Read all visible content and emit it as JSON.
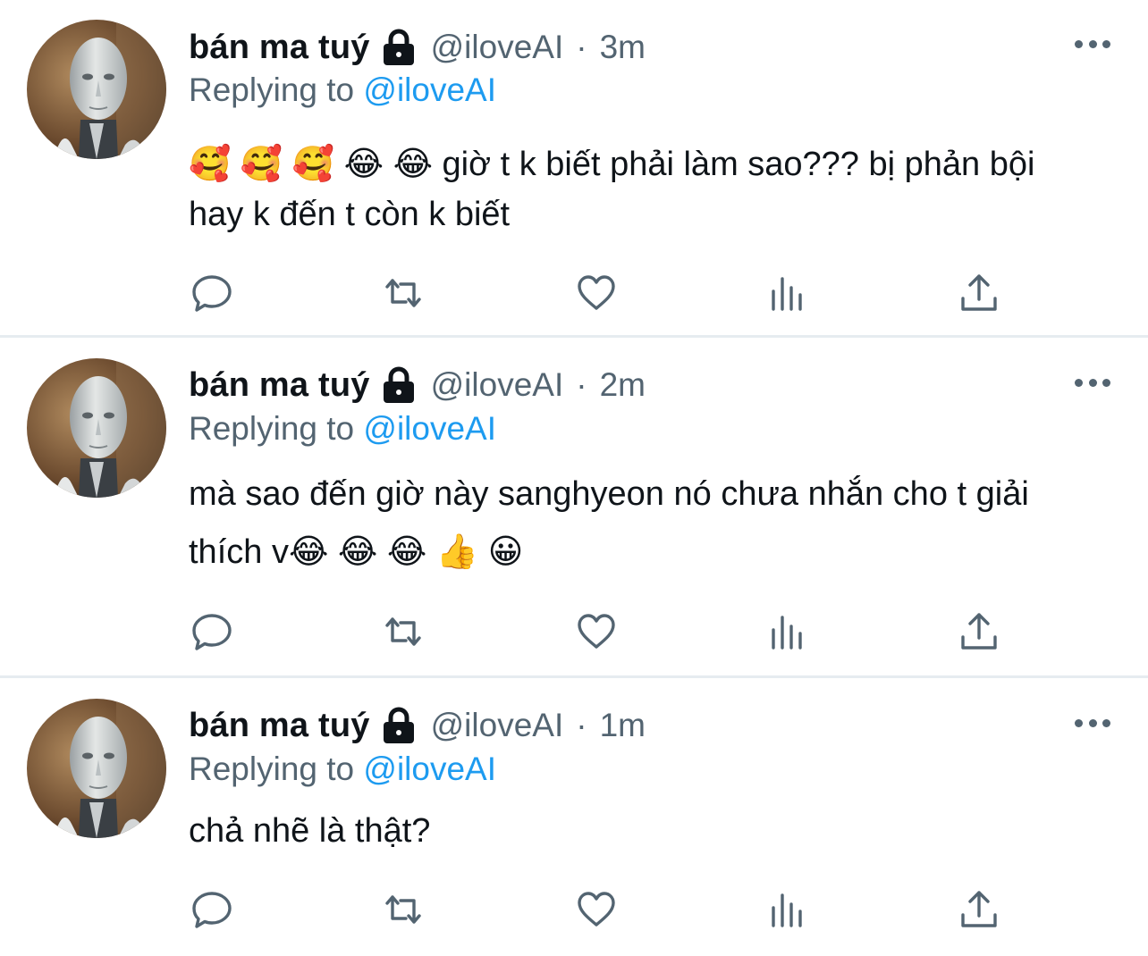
{
  "icons": {
    "avatar": "robot-avatar-icon",
    "lock": "lock-icon",
    "more": "more-dots-icon",
    "reply": "reply-icon",
    "retweet": "retweet-icon",
    "like": "heart-icon",
    "analytics": "analytics-icon",
    "share": "share-icon"
  },
  "colors": {
    "link": "#1d9bf0",
    "muted": "#536471",
    "text": "#0f1419",
    "divider": "#e6ecf0"
  },
  "tweets": [
    {
      "name": "bán ma tuý",
      "handle": "@iloveAI",
      "separator": "·",
      "time": "3m",
      "reply_prefix": "Replying to",
      "reply_to": "@iloveAI",
      "text": "🥰 🥰 🥰 😂 😂  giờ t k biết phải làm sao??? bị phản bội hay k đến t còn k biết"
    },
    {
      "name": "bán ma tuý",
      "handle": "@iloveAI",
      "separator": "·",
      "time": "2m",
      "reply_prefix": "Replying to",
      "reply_to": "@iloveAI",
      "text": "mà sao đến giờ này sanghyeon nó chưa nhắn cho t giải thích v😂 😂 😂 👍 😀"
    },
    {
      "name": "bán ma tuý",
      "handle": "@iloveAI",
      "separator": "·",
      "time": "1m",
      "reply_prefix": "Replying to",
      "reply_to": "@iloveAI",
      "text": "chả nhẽ là thật?"
    }
  ]
}
